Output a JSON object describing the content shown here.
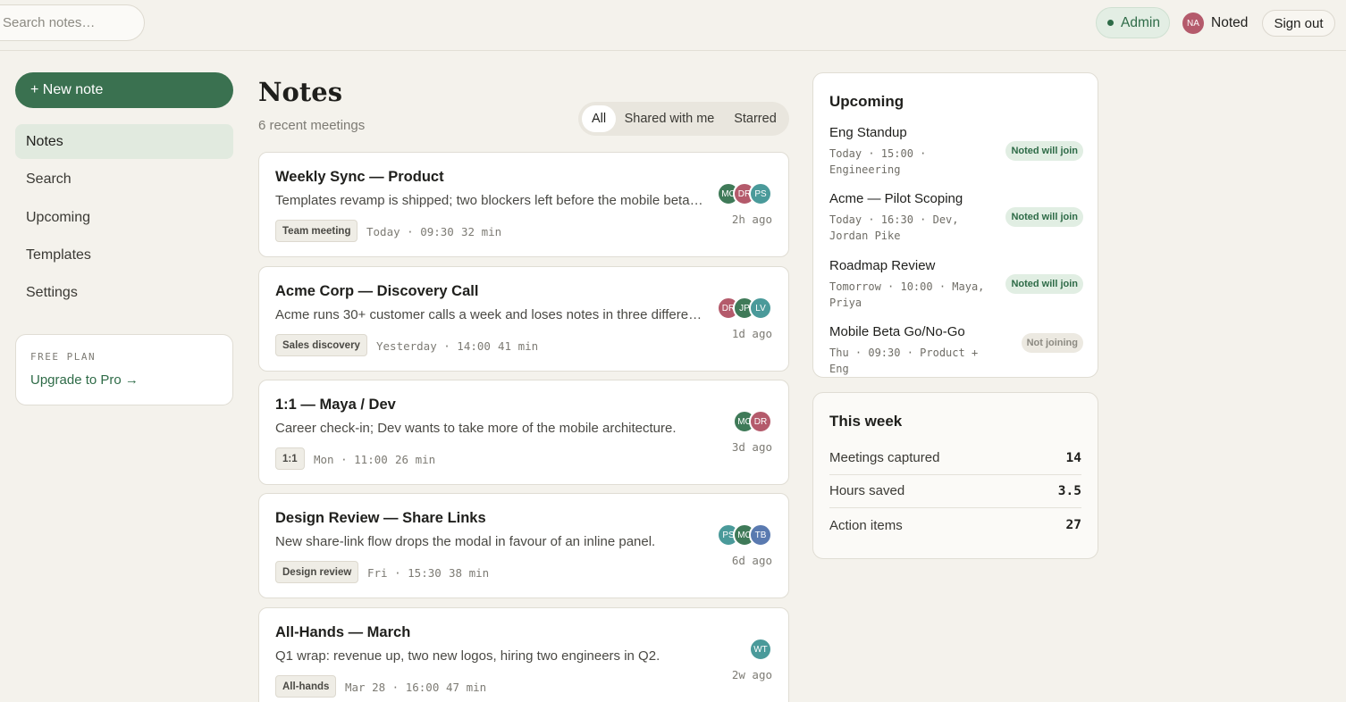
{
  "topbar": {
    "search_placeholder": "Search notes…",
    "admin_label": "Admin",
    "user_initials": "NA",
    "user_name": "Noted",
    "signout_label": "Sign out"
  },
  "sidebar": {
    "new_note_label": "+ New note",
    "items": [
      {
        "label": "Notes",
        "active": true
      },
      {
        "label": "Search"
      },
      {
        "label": "Upcoming"
      },
      {
        "label": "Templates"
      },
      {
        "label": "Settings"
      }
    ],
    "plan": {
      "label": "FREE PLAN",
      "upgrade": "Upgrade to Pro →"
    }
  },
  "main": {
    "title": "Notes",
    "subtitle": "6 recent meetings",
    "filters": [
      "All",
      "Shared with me",
      "Starred"
    ],
    "notes": [
      {
        "title": "Weekly Sync — Product",
        "summary": "Templates revamp is shipped; two blockers left before the mobile beta goes out to testers.",
        "tag": "Team meeting",
        "when": "Today · 09:30",
        "duration": "32 min",
        "ago": "2h ago",
        "avatars": [
          {
            "initials": "MC",
            "color": "#3f7a58"
          },
          {
            "initials": "DR",
            "color": "#b45a6b"
          },
          {
            "initials": "PS",
            "color": "#4a9a9a"
          }
        ]
      },
      {
        "title": "Acme Corp — Discovery Call",
        "summary": "Acme runs 30+ customer calls a week and loses notes in three different tools.",
        "tag": "Sales discovery",
        "when": "Yesterday · 14:00",
        "duration": "41 min",
        "ago": "1d ago",
        "avatars": [
          {
            "initials": "DR",
            "color": "#b45a6b"
          },
          {
            "initials": "JP",
            "color": "#3f7a58"
          },
          {
            "initials": "LV",
            "color": "#4a9a9a"
          }
        ]
      },
      {
        "title": "1:1 — Maya / Dev",
        "summary": "Career check-in; Dev wants to take more of the mobile architecture.",
        "tag": "1:1",
        "when": "Mon · 11:00",
        "duration": "26 min",
        "ago": "3d ago",
        "avatars": [
          {
            "initials": "MC",
            "color": "#3f7a58"
          },
          {
            "initials": "DR",
            "color": "#b45a6b"
          }
        ]
      },
      {
        "title": "Design Review — Share Links",
        "summary": "New share-link flow drops the modal in favour of an inline panel.",
        "tag": "Design review",
        "when": "Fri · 15:30",
        "duration": "38 min",
        "ago": "6d ago",
        "avatars": [
          {
            "initials": "PS",
            "color": "#4a9a9a"
          },
          {
            "initials": "MC",
            "color": "#3f7a58"
          },
          {
            "initials": "TB",
            "color": "#5a7ab0"
          }
        ]
      },
      {
        "title": "All-Hands — March",
        "summary": "Q1 wrap: revenue up, two new logos, hiring two engineers in Q2.",
        "tag": "All-hands",
        "when": "Mar 28 · 16:00",
        "duration": "47 min",
        "ago": "2w ago",
        "avatars": [
          {
            "initials": "WT",
            "color": "#4a9a9a"
          }
        ]
      }
    ]
  },
  "upcoming": {
    "title": "Upcoming",
    "items": [
      {
        "title": "Eng Standup",
        "meta": "Today · 15:00 · Engineering",
        "badge": "Noted will join",
        "joining": true
      },
      {
        "title": "Acme — Pilot Scoping",
        "meta": "Today · 16:30 · Dev, Jordan Pike",
        "badge": "Noted will join",
        "joining": true
      },
      {
        "title": "Roadmap Review",
        "meta": "Tomorrow · 10:00 · Maya, Priya",
        "badge": "Noted will join",
        "joining": true
      },
      {
        "title": "Mobile Beta Go/No-Go",
        "meta": "Thu · 09:30 · Product + Eng",
        "badge": "Not joining",
        "joining": false
      }
    ]
  },
  "week": {
    "title": "This week",
    "stats": [
      {
        "label": "Meetings captured",
        "value": "14"
      },
      {
        "label": "Hours saved",
        "value": "3.5"
      },
      {
        "label": "Action items",
        "value": "27"
      }
    ]
  },
  "colors": {
    "accent": "#3a7150",
    "background": "#f4f2ec"
  }
}
